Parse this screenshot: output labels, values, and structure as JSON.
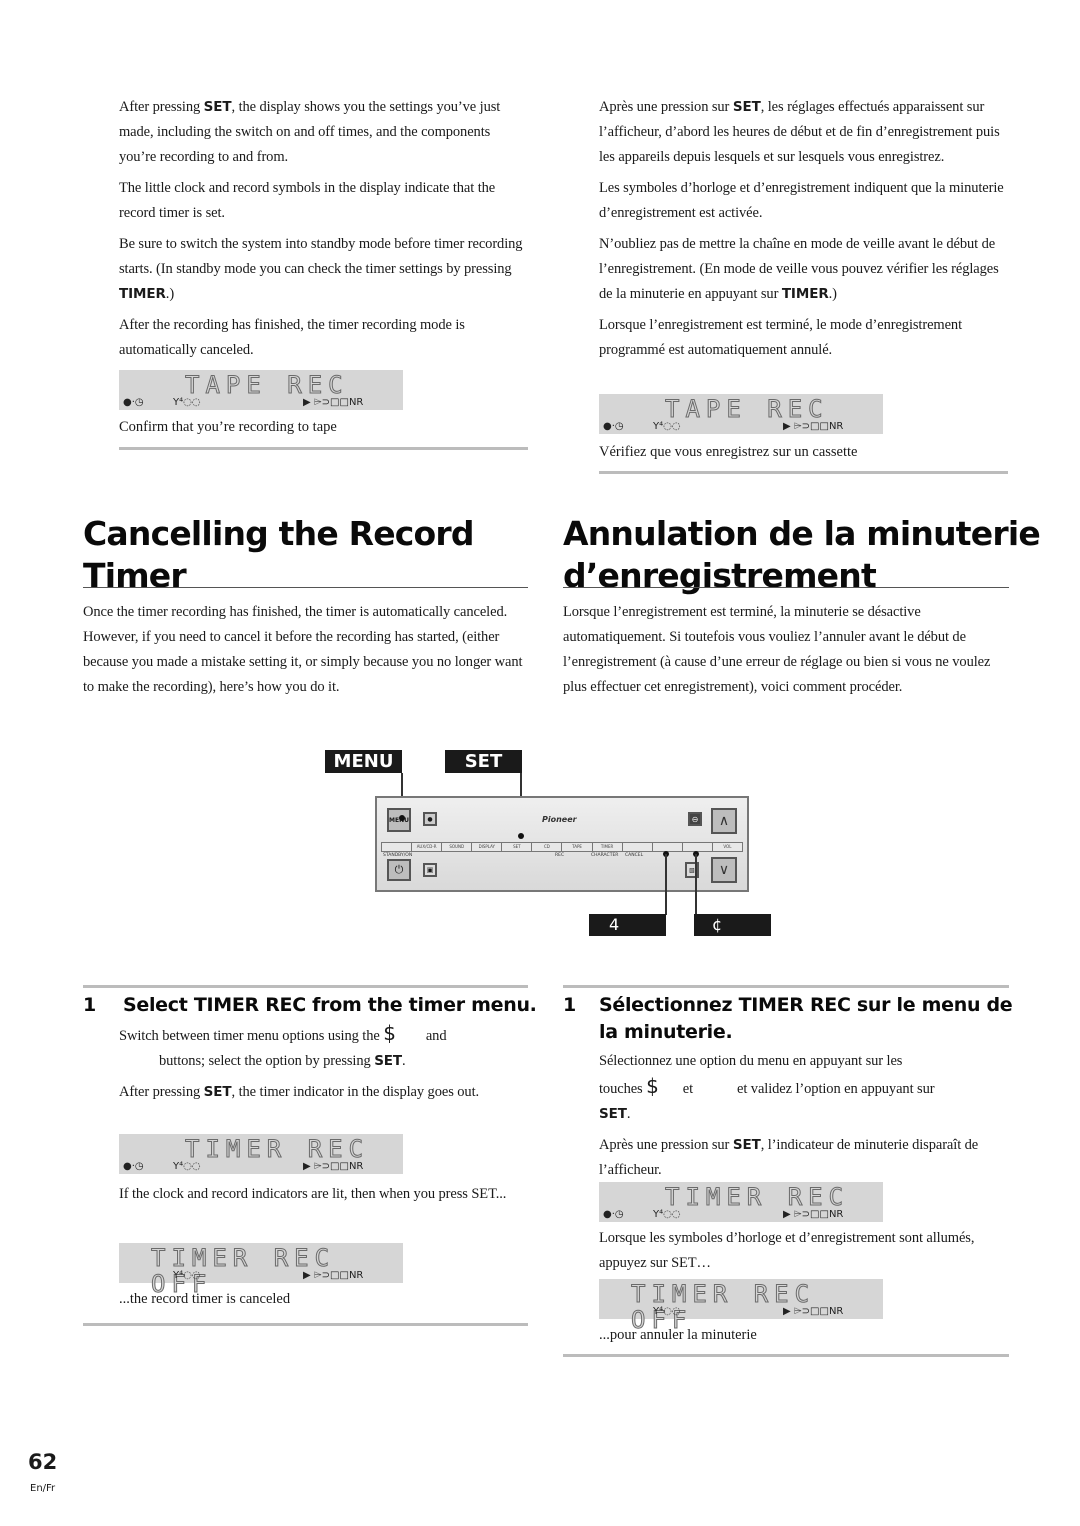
{
  "left_top": {
    "p1": [
      "After pressing ",
      "SET",
      ", the display shows you the settings you’ve just made, including the switch on and off times, and the components you’re recording to and from."
    ],
    "p2": "The little clock and record symbols in the display indicate that the record timer is set.",
    "p3": [
      "Be sure to switch the system into standby mode before timer recording starts. (In standby mode you can check the timer settings by pressing ",
      "TIMER",
      ".)"
    ],
    "p4": "After the recording has finished, the timer recording mode is automatically canceled.",
    "display": "TAPE REC",
    "caption": "Confirm that you’re recording to tape"
  },
  "right_top": {
    "p1": [
      "Après une pression sur ",
      "SET",
      ", les réglages effectués apparaissent sur l’afficheur, d’abord les heures de début et de fin d’enregistrement puis les appareils depuis lesquels et sur lesquels vous enregistrez."
    ],
    "p2": "Les symboles d’horloge et d’enregistrement indiquent que la minuterie d’enregistrement est activée.",
    "p3": [
      "N’oubliez pas de mettre la chaîne en mode de veille avant le début de l’enregistrement. (En mode de veille vous pouvez vérifier les réglages de la minuterie en appuyant sur ",
      "TIMER",
      ".)"
    ],
    "p4": "Lorsque l’enregistrement est terminé, le mode d’enregistrement programmé est automatiquement annulé.",
    "display": "TAPE REC",
    "caption": "Vérifiez que vous enregistrez sur un cassette"
  },
  "left_section": {
    "title_line1": "Cancelling the Record",
    "title_line2": "Timer",
    "intro": "Once the timer recording has finished, the timer is automatically canceled. However, if you need to cancel it before the recording has started, (either because you made a mistake setting it, or simply because you no longer want to make the recording), here’s how you do it."
  },
  "right_section": {
    "title_line1": "Annulation de la minuterie",
    "title_line2": "d’enregistrement",
    "intro": "Lorsque l’enregistrement est terminé, la minuterie se désactive automatiquement. Si toutefois vous vouliez l’annuler avant le début de l’enregistrement (à cause d’une erreur de réglage ou bien si vous ne voulez plus effectuer cet enregistrement), voici comment procéder."
  },
  "diagram": {
    "menu_label": "MENU",
    "set_label": "SET",
    "label_4": "4",
    "label_cent": "¢",
    "menu_button": "MENU",
    "brand": "Pioneer",
    "standby": "STANDBY/ON",
    "strip": [
      "",
      "AUX/CD-R",
      "SOUND",
      "DISPLAY",
      "SET",
      "CD",
      "TAPE",
      "TIMER",
      "",
      "",
      "",
      "VOL"
    ],
    "row2": [
      "REC",
      "CHARACTER",
      "CANCEL"
    ]
  },
  "left_step": {
    "number": "1",
    "title": "Select TIMER REC from the timer menu.",
    "p1a": "Switch between timer menu options using the ",
    "p1sym": "$",
    "p1b": "and",
    "p1c": "buttons; select the option by pressing ",
    "p1d": "SET",
    "p2": [
      "After pressing ",
      "SET",
      ", the timer indicator in the display goes out."
    ],
    "display1": "TIMER REC",
    "cap1": "If the clock and record indicators are lit, then when you press SET...",
    "display2": "TIMER REC OFF",
    "cap2": "...the record timer is canceled"
  },
  "right_step": {
    "number": "1",
    "title_line1": "Sélectionnez TIMER REC sur le menu de",
    "title_line2": "la minuterie.",
    "p1a": "Sélectionnez une option du menu en appuyant sur les",
    "p1b": "touches ",
    "p1sym": "$",
    "p1c": "et",
    "p1d": "et validez l’option en appuyant sur",
    "p1e": "SET",
    "p2": [
      "Après une pression sur ",
      "SET",
      ", l’indicateur de minuterie disparaît de l’afficheur."
    ],
    "display1": "TIMER REC",
    "cap1": "Lorsque les symboles d’horloge et d’enregistrement sont allumés, appuyez sur SET…",
    "display2": "TIMER REC OFF",
    "cap2": "...pour annuler la minuterie"
  },
  "lcd_indicators": {
    "timer": "●·◷",
    "tuner": "Y⁴◌◌",
    "right": "▶  ⌲⊃□□NR"
  },
  "footer": {
    "page": "62",
    "lang": "En/Fr"
  }
}
